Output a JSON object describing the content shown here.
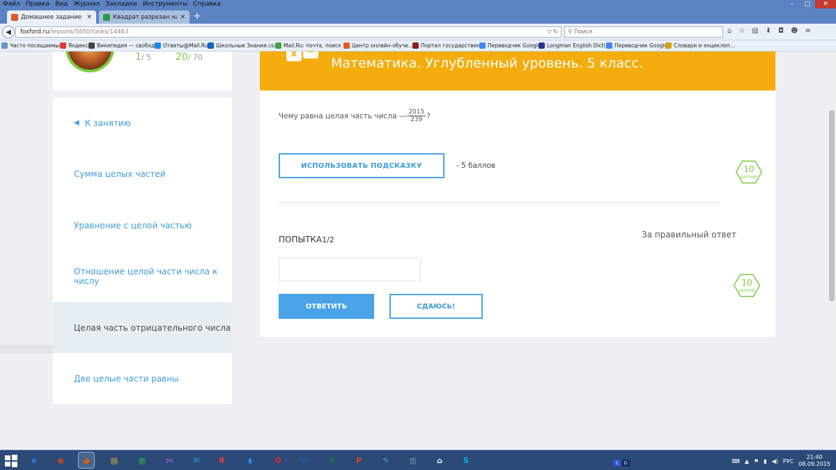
{
  "browser": {
    "menu": [
      "Файл",
      "Правка",
      "Вид",
      "Журнал",
      "Закладки",
      "Инструменты",
      "Справка"
    ],
    "window_controls": {
      "minimize": "–",
      "maximize": "□",
      "close": "✕"
    },
    "tabs": [
      {
        "label": "Домашнее задание",
        "active": true,
        "favicon_color": "#e05a2b"
      },
      {
        "label": "Квадрат разрезан на пря...",
        "active": false,
        "favicon_color": "#2a9d4b"
      }
    ],
    "url": {
      "host": "foxford.ru",
      "path": "/lessons/5850/tasks/14463"
    },
    "search_placeholder": "Поиск",
    "bookmarks": [
      {
        "label": "Часто посещаемые",
        "color": "#6b8fc7"
      },
      {
        "label": "Яндекс",
        "color": "#e53935"
      },
      {
        "label": "Википедия — свобод...",
        "color": "#444444"
      },
      {
        "label": "Ответы@Mail.Ru",
        "color": "#1e88e5"
      },
      {
        "label": "Школьные Знания.co...",
        "color": "#1565c0"
      },
      {
        "label": "Mail.Ru: почта, поиск ...",
        "color": "#43a047"
      },
      {
        "label": "Центр онлайн-обуче...",
        "color": "#e05a2b"
      },
      {
        "label": "Портал государствен...",
        "color": "#8e1b1b"
      },
      {
        "label": "Переводчик Google",
        "color": "#4285f4"
      },
      {
        "label": "Longman English Dicti...",
        "color": "#283593"
      },
      {
        "label": "Переводчик Google",
        "color": "#4285f4"
      },
      {
        "label": "Словари и энциклоп...",
        "color": "#d4a017"
      }
    ]
  },
  "profile": {
    "stat1": {
      "value": "1",
      "total": "/ 5"
    },
    "stat2": {
      "value": "20",
      "total": "/ 70"
    }
  },
  "sidebar": {
    "back_label": "К занятию",
    "items": [
      {
        "label": "Сумма целых частей",
        "active": false
      },
      {
        "label": "Уравнение с целой частью",
        "active": false
      },
      {
        "label": "Отношение целой части числа к числу",
        "active": false
      },
      {
        "label": "Целая часть отрицательного числа",
        "active": true
      },
      {
        "label": "Две целые части равны",
        "active": false
      }
    ]
  },
  "banner": {
    "icon_left": "x",
    "icon_right": "=",
    "title": "Математика. Углубленный уровень. 5 класс."
  },
  "task": {
    "question_prefix": "Чему равна целая часть числа —",
    "fraction_numerator": "2015",
    "fraction_denominator": "239",
    "question_suffix": "?",
    "points_value": "10",
    "points_unit": "БАЛЛОВ",
    "hint_button": "ИСПОЛЬЗОВАТЬ ПОДСКАЗКУ",
    "hint_cost": "- 5 баллов",
    "attempt_label": "ПОПЫТКА",
    "attempt_count": "1/2",
    "correct_answer_label": "За правильный ответ",
    "correct_points_value": "10",
    "correct_points_unit": "БАЛЛОВ",
    "answer_value": "",
    "submit_button": "ОТВЕТИТЬ",
    "giveup_button": "СДАЮСЬ!"
  },
  "taskbar": {
    "apps": [
      {
        "name": "ie",
        "glyph": "e",
        "color": "#1e88e5"
      },
      {
        "name": "eye",
        "glyph": "◉",
        "color": "#d84315"
      },
      {
        "name": "firefox",
        "glyph": "◕",
        "color": "#e66000"
      },
      {
        "name": "explorer",
        "glyph": "▤",
        "color": "#e2b13c"
      },
      {
        "name": "store",
        "glyph": "▦",
        "color": "#2e9e4f"
      },
      {
        "name": "vs",
        "glyph": "⋈",
        "color": "#7e57c2"
      },
      {
        "name": "mail",
        "glyph": "✉",
        "color": "#26a0da"
      },
      {
        "name": "yandex",
        "glyph": "Я",
        "color": "#e53935"
      },
      {
        "name": "sound",
        "glyph": "◖",
        "color": "#2196f3"
      },
      {
        "name": "opera",
        "glyph": "O",
        "color": "#e0252f"
      },
      {
        "name": "word",
        "glyph": "W",
        "color": "#2b579a"
      },
      {
        "name": "excel",
        "glyph": "X",
        "color": "#217346"
      },
      {
        "name": "powerpoint",
        "glyph": "P",
        "color": "#d24726"
      },
      {
        "name": "notes",
        "glyph": "✎",
        "color": "#5c9bd6"
      },
      {
        "name": "calc",
        "glyph": "▥",
        "color": "#7a8ca8"
      },
      {
        "name": "home",
        "glyph": "⌂",
        "color": "#ffffff"
      },
      {
        "name": "skype",
        "glyph": "S",
        "color": "#00aff0"
      }
    ],
    "lang_indicator": [
      "C",
      "D"
    ],
    "lang": "РУС",
    "time": "21:40",
    "date": "08.09.2015"
  }
}
